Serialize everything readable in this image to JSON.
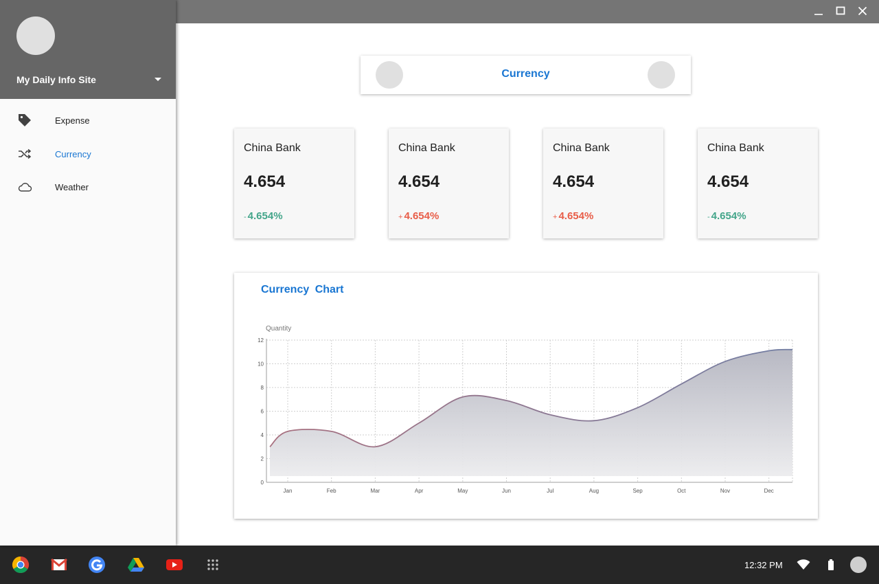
{
  "sidebar": {
    "site_title": "My Daily Info Site",
    "items": [
      {
        "label": "Expense",
        "icon": "tag-icon",
        "active": false
      },
      {
        "label": "Currency",
        "icon": "shuffle-icon",
        "active": true
      },
      {
        "label": "Weather",
        "icon": "cloud-icon",
        "active": false
      }
    ]
  },
  "header": {
    "title": "Currency"
  },
  "cards": [
    {
      "name": "China Bank",
      "rate": "4.654",
      "sign": "-",
      "change": "4.654%",
      "trend": "down"
    },
    {
      "name": "China Bank",
      "rate": "4.654",
      "sign": "+",
      "change": "4.654%",
      "trend": "up"
    },
    {
      "name": "China Bank",
      "rate": "4.654",
      "sign": "+",
      "change": "4.654%",
      "trend": "up"
    },
    {
      "name": "China Bank",
      "rate": "4.654",
      "sign": "-",
      "change": "4.654%",
      "trend": "down"
    }
  ],
  "colors": {
    "accent": "#1976d2",
    "up": "#e85d48",
    "down": "#43a58a",
    "header": "#666666",
    "taskbar": "#262626"
  },
  "chart_data": {
    "type": "area",
    "title": "Currency  Chart",
    "ylabel": "Quantity",
    "xlabel": "",
    "ylim": [
      0,
      12
    ],
    "yticks": [
      0,
      2,
      4,
      6,
      8,
      10,
      12
    ],
    "grid": true,
    "categories": [
      "Jan",
      "Feb",
      "Mar",
      "Apr",
      "May",
      "Jun",
      "Jul",
      "Aug",
      "Sep",
      "Oct",
      "Nov",
      "Dec"
    ],
    "series": [
      {
        "values": [
          4.3,
          4.3,
          3.0,
          5.0,
          7.2,
          6.9,
          5.7,
          5.2,
          6.3,
          8.3,
          10.2,
          11.1
        ]
      }
    ]
  },
  "taskbar": {
    "apps": [
      "chrome-icon",
      "gmail-icon",
      "google-icon",
      "drive-icon",
      "youtube-icon",
      "launcher-icon"
    ],
    "time": "12:32 PM"
  }
}
